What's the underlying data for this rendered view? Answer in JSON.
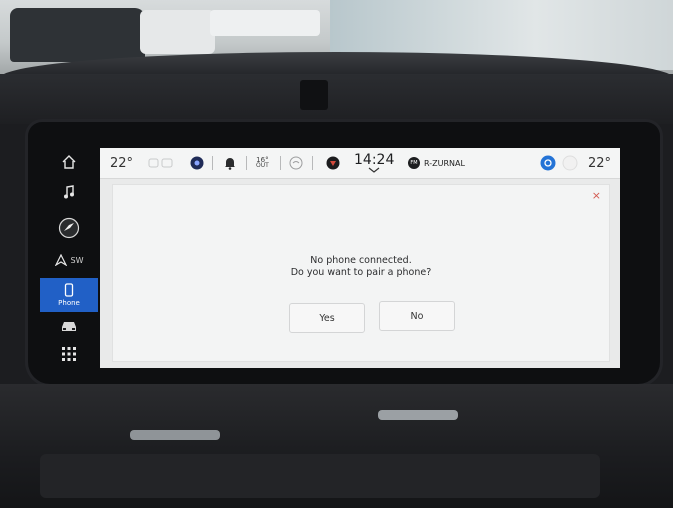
{
  "status_bar": {
    "temp_left": "22°",
    "outside_temp": "16°",
    "outside_label": "OUT",
    "time": "14:24",
    "radio_badge": "FM",
    "radio_station": "R-ZURNAL",
    "temp_right": "22°"
  },
  "rail": {
    "items": [
      {
        "icon": "home-icon"
      },
      {
        "icon": "music-note-icon"
      },
      {
        "icon": "navigation-icon"
      },
      {
        "icon": "compass-icon",
        "label": "SW"
      },
      {
        "icon": "phone-icon",
        "label": "Phone",
        "active": true
      },
      {
        "icon": "vehicle-icon"
      },
      {
        "icon": "app-grid-icon"
      }
    ]
  },
  "dialog": {
    "line1": "No phone connected.",
    "line2": "Do you want to pair a phone?",
    "yes_label": "Yes",
    "no_label": "No",
    "close_label": "×"
  },
  "colors": {
    "accent": "#2160c6",
    "close": "#d2584f",
    "screen_bg": "#e9eaea"
  }
}
